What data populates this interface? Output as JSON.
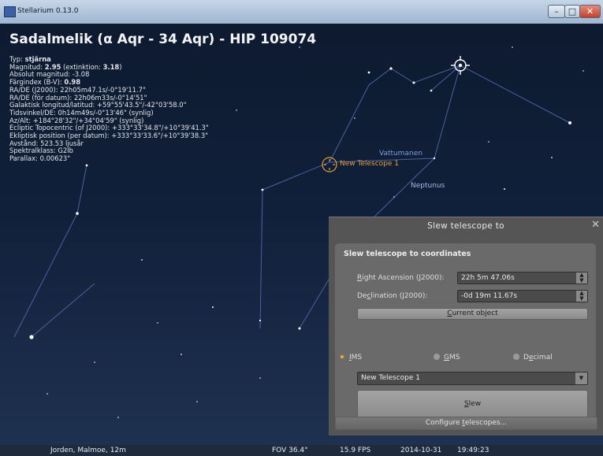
{
  "window": {
    "title": "Stellarium 0.13.0",
    "minimize_glyph": "–",
    "maximize_glyph": "□",
    "close_glyph": "✕"
  },
  "object_info": {
    "title": "Sadalmelik (α Aqr - 34 Aqr) - HIP 109074",
    "lines": [
      {
        "label": "Typ: ",
        "value": "stjärna"
      },
      {
        "label": "Magnitud: ",
        "value": "2.95",
        "extra": " (extinktion: ",
        "extra_bold": "3.18",
        "extra_end": ")"
      },
      {
        "label": "Absolut magnitud: -3.08"
      },
      {
        "label": "Färgindex (B-V): ",
        "value": "0.98"
      },
      {
        "label": "RA/DE (J2000): 22h05m47.1s/-0°19'11.7\""
      },
      {
        "label": "RA/DE (för datum): 22h06m33s/-0°14'51\""
      },
      {
        "label": "Galaktisk longitud/latitud: +59°55'43.5\"/-42°03'58.0\""
      },
      {
        "label": "Tidsvinkel/DE: 0h14m49s/-0°13'46\" (synlig)"
      },
      {
        "label": "Az/Alt: +184°28'32\"/+34°04'59\" (synlig)"
      },
      {
        "label": "Ecliptic Topocentric (of J2000): +333°33'34.8\"/+10°39'41.3\""
      },
      {
        "label": "Ekliptisk position (per datum): +333°33'33.6\"/+10°39'38.3\""
      },
      {
        "label": "Avstånd: 523.53 ljusår"
      },
      {
        "label": "Spektralklass: G2Ib"
      },
      {
        "label": "Parallax: 0.00623\""
      }
    ]
  },
  "sky_labels": {
    "telescope": "New Telescope 1",
    "constellation": "Vattumanen",
    "planet": "Neptunus"
  },
  "status": {
    "location": "Jorden, Malmoe, 12m",
    "fov": "FOV 36.4°",
    "fps": "15.9 FPS",
    "date": "2014-10-31",
    "time": "19:49:23"
  },
  "dialog": {
    "title": "Slew telescope to",
    "close_glyph": "✕",
    "section": "Slew telescope to coordinates",
    "ra_label": {
      "key": "R",
      "rest": "ight Ascension (J2000):"
    },
    "ra_value": "22h 5m 47.06s",
    "dec_label": {
      "pre": "De",
      "key": "c",
      "rest": "lination (J2000):"
    },
    "dec_value": "-0d 19m 11.67s",
    "current_object": {
      "key": "C",
      "rest": "urrent object"
    },
    "radios": [
      {
        "key": "I",
        "rest": "MS",
        "selected": true
      },
      {
        "key": "G",
        "rest": "MS",
        "selected": false
      },
      {
        "pre": "D",
        "key": "e",
        "rest": "cimal",
        "selected": false
      }
    ],
    "telescope_select": "New Telescope 1",
    "slew_button": {
      "key": "S",
      "rest": "lew"
    },
    "configure_button": {
      "pre": "Configure ",
      "key": "t",
      "rest": "elescopes..."
    }
  },
  "colors": {
    "telescope_marker": "#e8a030",
    "constellation_label": "#7f9fe0",
    "radio_selected": "#f0b030",
    "lines": "#5b6fb0"
  },
  "icons": {
    "pointer": "selection-crosshair-icon",
    "telescope": "telescope-reticle-icon",
    "spinner": "spin-arrows-icon",
    "dropdown": "chevron-down-icon"
  }
}
